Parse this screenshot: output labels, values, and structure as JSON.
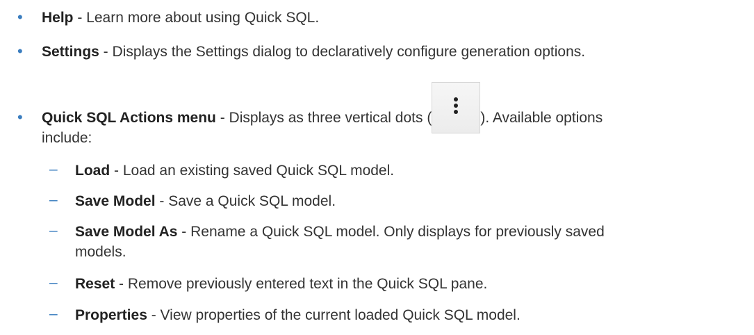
{
  "items": [
    {
      "term": "Help",
      "desc": " - Learn more about using Quick SQL."
    },
    {
      "term": "Settings",
      "desc": " - Displays the Settings dialog to declaratively configure generation options."
    },
    {
      "term": "Quick SQL Actions menu",
      "desc_before": " - Displays as three vertical dots (",
      "desc_after": "). Available options",
      "desc_line2": "include:",
      "icon": "three-vertical-dots-icon"
    }
  ],
  "subitems": [
    {
      "term": "Load",
      "desc": " - Load an existing saved Quick SQL model."
    },
    {
      "term": "Save Model",
      "desc": " - Save a Quick SQL model."
    },
    {
      "term": "Save Model As",
      "desc": " - Rename a Quick SQL model. Only displays for previously saved",
      "desc_line2": "models."
    },
    {
      "term": "Reset",
      "desc": " - Remove previously entered text in the Quick SQL pane."
    },
    {
      "term": "Properties",
      "desc": " - View properties of the current loaded Quick SQL model."
    }
  ],
  "markers": {
    "bullet": "•",
    "dash": "–"
  },
  "colors": {
    "marker": "#3a7dbf",
    "text": "#333333"
  }
}
